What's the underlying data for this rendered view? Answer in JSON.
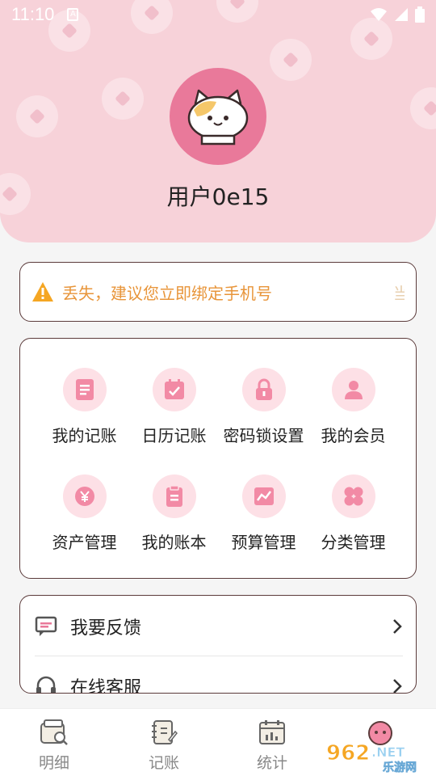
{
  "status_bar": {
    "time": "11:10",
    "indicator": "A"
  },
  "profile": {
    "username": "用户0e15"
  },
  "notice": {
    "text": "丢失，建议您立即绑定手机号",
    "tail": "当",
    "icon": "warning-icon"
  },
  "features": [
    {
      "label": "我的记账",
      "icon": "ledger-icon"
    },
    {
      "label": "日历记账",
      "icon": "calendar-icon"
    },
    {
      "label": "密码锁设置",
      "icon": "lock-icon"
    },
    {
      "label": "我的会员",
      "icon": "member-icon"
    },
    {
      "label": "资产管理",
      "icon": "yen-icon"
    },
    {
      "label": "我的账本",
      "icon": "book-icon"
    },
    {
      "label": "预算管理",
      "icon": "chart-icon"
    },
    {
      "label": "分类管理",
      "icon": "clover-icon"
    }
  ],
  "menu": [
    {
      "label": "我要反馈",
      "icon": "feedback-icon"
    },
    {
      "label": "在线客服",
      "icon": "headset-icon"
    }
  ],
  "tabs": [
    {
      "label": "明细",
      "icon": "detail-icon"
    },
    {
      "label": "记账",
      "icon": "note-icon"
    },
    {
      "label": "统计",
      "icon": "stats-icon"
    }
  ],
  "watermark": {
    "text": "962.NET",
    "subtext": "乐游网"
  },
  "colors": {
    "header_bg": "#f7d2d9",
    "accent": "#e9799a",
    "icon_bg": "#fde0e6",
    "notice_text": "#e8953a"
  }
}
